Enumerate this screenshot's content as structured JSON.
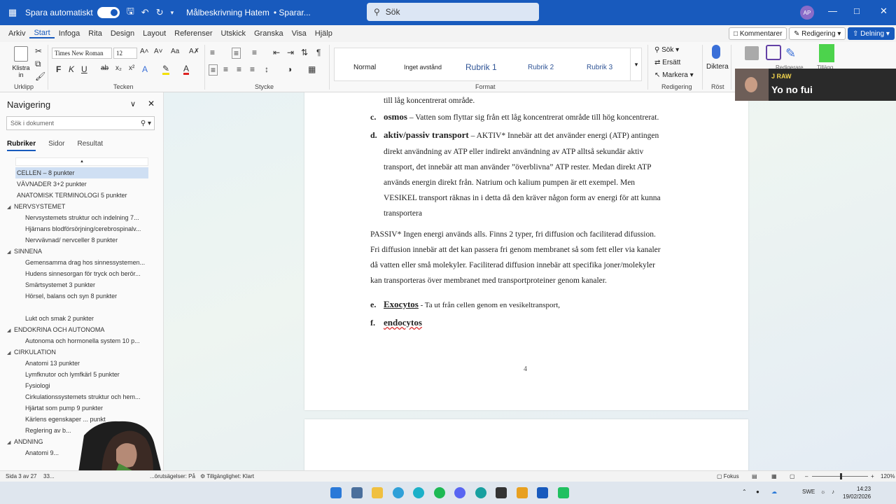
{
  "titlebar": {
    "autosave_label": "Spara automatiskt",
    "doc_title": "Målbeskrivning Hatem",
    "save_status": "• Sparar...",
    "search_placeholder": "Sök",
    "avatar_initials": "AP"
  },
  "menu": {
    "tabs": [
      "Arkiv",
      "Start",
      "Infoga",
      "Rita",
      "Design",
      "Layout",
      "Referenser",
      "Utskick",
      "Granska",
      "Visa",
      "Hjälp"
    ],
    "active": "Start",
    "comments_label": "Kommentarer",
    "editing_label": "Redigering",
    "share_label": "Delning"
  },
  "ribbon": {
    "paste_label": "Klistra in",
    "clipboard_label": "Urklipp",
    "font_name": "Times New Roman",
    "font_size": "12",
    "font_group_label": "Tecken",
    "paragraph_label": "Stycke",
    "styles": [
      "Normal",
      "Inget avstånd",
      "Rubrik 1",
      "Rubrik 2",
      "Rubrik 3"
    ],
    "styles_label": "Format",
    "find_label": "Sök",
    "replace_label": "Ersätt",
    "select_label": "Markera",
    "editing_group_label": "Redigering",
    "dictate_label": "Diktera",
    "voice_label": "Röst",
    "editor_label": "Redigerare",
    "addins_label": "Tillägg"
  },
  "nav": {
    "title": "Navigering",
    "search_placeholder": "Sök i dokument",
    "tabs": [
      "Rubriker",
      "Sidor",
      "Resultat"
    ],
    "headings": [
      {
        "text": "CELLEN – 8 punkter",
        "level": 1,
        "selected": true
      },
      {
        "text": "VÄVNADER 3+2 punkter",
        "level": 1
      },
      {
        "text": "ANATOMISK TERMINOLOGI 5 punkter",
        "level": 1
      },
      {
        "text": "NERVSYSTEMET",
        "level": 1,
        "expanded": true
      },
      {
        "text": "Nervsystemets struktur och indelning 7...",
        "level": 2
      },
      {
        "text": "Hjärnans blodförsörjning/cerebrospinalv...",
        "level": 2
      },
      {
        "text": "Nervvävnad/ nervceller 8 punkter",
        "level": 2
      },
      {
        "text": "SINNENA",
        "level": 1,
        "expanded": true
      },
      {
        "text": "Gemensamma drag hos sinnessystemen...",
        "level": 2
      },
      {
        "text": "Hudens sinnesorgan för tryck och berör...",
        "level": 2
      },
      {
        "text": "Smärtsystemet 3 punkter",
        "level": 2
      },
      {
        "text": "Hörsel, balans och syn 8 punkter",
        "level": 2
      },
      {
        "text": "Lukt och smak 2 punkter",
        "level": 2
      },
      {
        "text": "ENDOKRINA OCH AUTONOMA",
        "level": 1,
        "expanded": true
      },
      {
        "text": "Autonoma och hormonella system 10 p...",
        "level": 2
      },
      {
        "text": "CIRKULATION",
        "level": 1,
        "expanded": true
      },
      {
        "text": "Anatomi 13 punkter",
        "level": 2
      },
      {
        "text": "Lymfknutor och lymfkärl 5 punkter",
        "level": 2
      },
      {
        "text": "Fysiologi",
        "level": 2
      },
      {
        "text": "Cirkulationssystemets struktur och hem...",
        "level": 2
      },
      {
        "text": "Hjärtat som pump 9 punkter",
        "level": 2
      },
      {
        "text": "Kärlens egenskaper ... punkt",
        "level": 2
      },
      {
        "text": "Reglering av b...",
        "level": 2
      },
      {
        "text": "ANDNING",
        "level": 1,
        "expanded": true
      },
      {
        "text": "Anatomi 9...",
        "level": 2
      }
    ]
  },
  "document": {
    "line_top": "till låg koncentrerat område.",
    "c_letter": "c.",
    "c_term": "osmos",
    "c_text": " – Vatten som flyttar sig från ett låg koncentrerat område till hög koncentrerat.",
    "d_letter": "d.",
    "d_term": "aktiv/passiv transport",
    "d_lines": [
      " – AKTIV* Innebär att det använder energi (ATP) antingen",
      "direkt användning av ATP eller indirekt användning av ATP alltså sekundär aktiv",
      "transport, det innebär att man använder ”överblivna” ATP rester. Medan direkt ATP",
      "används energin direkt från. Natrium och kalium pumpen är ett exempel. Men",
      "VESIKEL transport räknas in i detta då den kräver någon form av energi för att kunna",
      "transportera"
    ],
    "passive_lines": [
      "PASSIV* Ingen energi används alls. Finns 2 typer, fri diffusion och faciliterad difussion.",
      "Fri diffusion innebär att det kan passera fri genom membranet så som fett eller via kanaler",
      "då vatten eller små molekyler. Faciliterad diffusion innebär att specifika joner/molekyler",
      "kan transporteras över membranet med transportproteiner genom kanaler."
    ],
    "e_letter": "e.",
    "e_term": "Exocytos",
    "e_text": " -  Ta ut från cellen genom en vesikeltransport,",
    "f_letter": "f.",
    "f_term": "endocytos",
    "page_number": "4"
  },
  "overlay": {
    "name": "J RAW",
    "message": "Yo no fui"
  },
  "status": {
    "page": "Sida 3 av 27",
    "words": "33...",
    "predictions": "...örutsägelser: På",
    "accessibility": "Tillgänglighet: Klart",
    "focus": "Fokus",
    "zoom": "120%"
  },
  "taskbar": {
    "lang": "SWE",
    "time": "14:23",
    "date": "19/02/2026"
  },
  "colors": {
    "accent": "#185abd",
    "nav_selected": "#cfdff3"
  }
}
